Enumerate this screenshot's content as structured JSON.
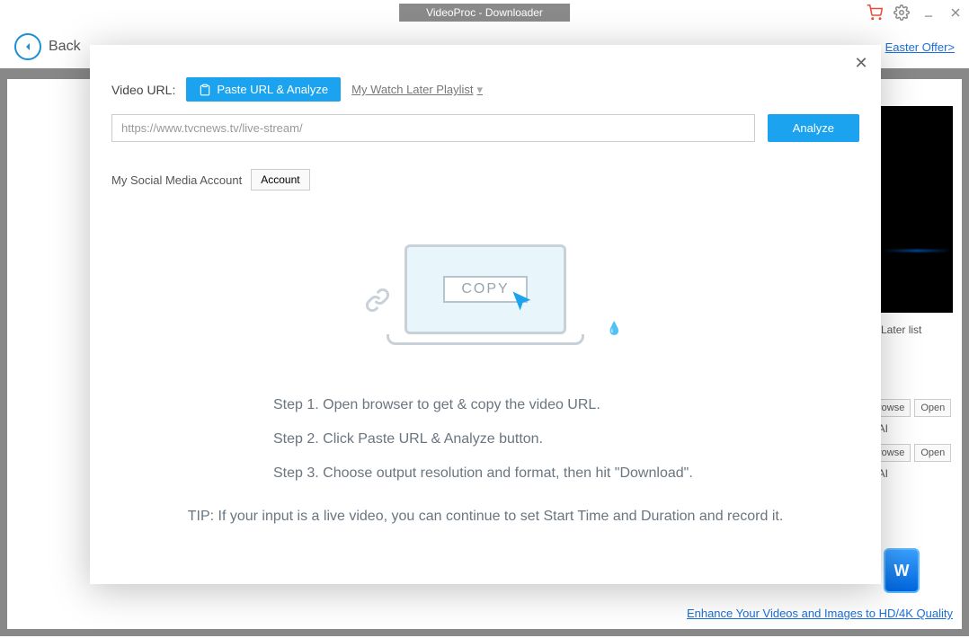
{
  "titlebar": {
    "title": "VideoProc - Downloader"
  },
  "topbar": {
    "back": "Back",
    "offer": "Easter Offer>"
  },
  "dialog": {
    "url_label": "Video URL:",
    "paste_btn": "Paste URL & Analyze",
    "watch_later": "My Watch Later Playlist",
    "url_value": "https://www.tvcnews.tv/live-stream/",
    "analyze": "Analyze",
    "social_label": "My Social Media Account",
    "account_btn": "Account",
    "copy_label": "COPY",
    "step1": "Step 1. Open browser to get & copy the video URL.",
    "step2": "Step 2. Click Paste URL & Analyze button.",
    "step3": "Step 3. Choose output resolution and format, then hit \"Download\".",
    "tip": "TIP: If your input is a live video, you can continue to set Start Time and Duration and record it."
  },
  "right": {
    "later_list": "h Later list",
    "browse": "rowse",
    "open": "Open",
    "ai": "r AI",
    "dl_btn": "W"
  },
  "bottom_link": "Enhance Your Videos and Images to HD/4K Quality"
}
